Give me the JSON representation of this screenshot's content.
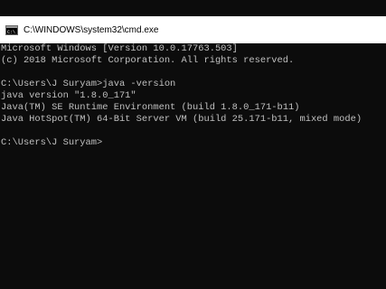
{
  "window": {
    "title": "C:\\WINDOWS\\system32\\cmd.exe",
    "icon": "cmd-icon"
  },
  "colors": {
    "console_background": "#0c0c0c",
    "console_text": "#c0c0c0",
    "titlebar_background": "#ffffff"
  },
  "console": {
    "lines": [
      "Microsoft Windows [Version 10.0.17763.503]",
      "(c) 2018 Microsoft Corporation. All rights reserved.",
      "",
      "C:\\Users\\J Suryam>java -version",
      "java version \"1.8.0_171\"",
      "Java(TM) SE Runtime Environment (build 1.8.0_171-b11)",
      "Java HotSpot(TM) 64-Bit Server VM (build 25.171-b11, mixed mode)",
      "",
      "C:\\Users\\J Suryam>"
    ]
  }
}
